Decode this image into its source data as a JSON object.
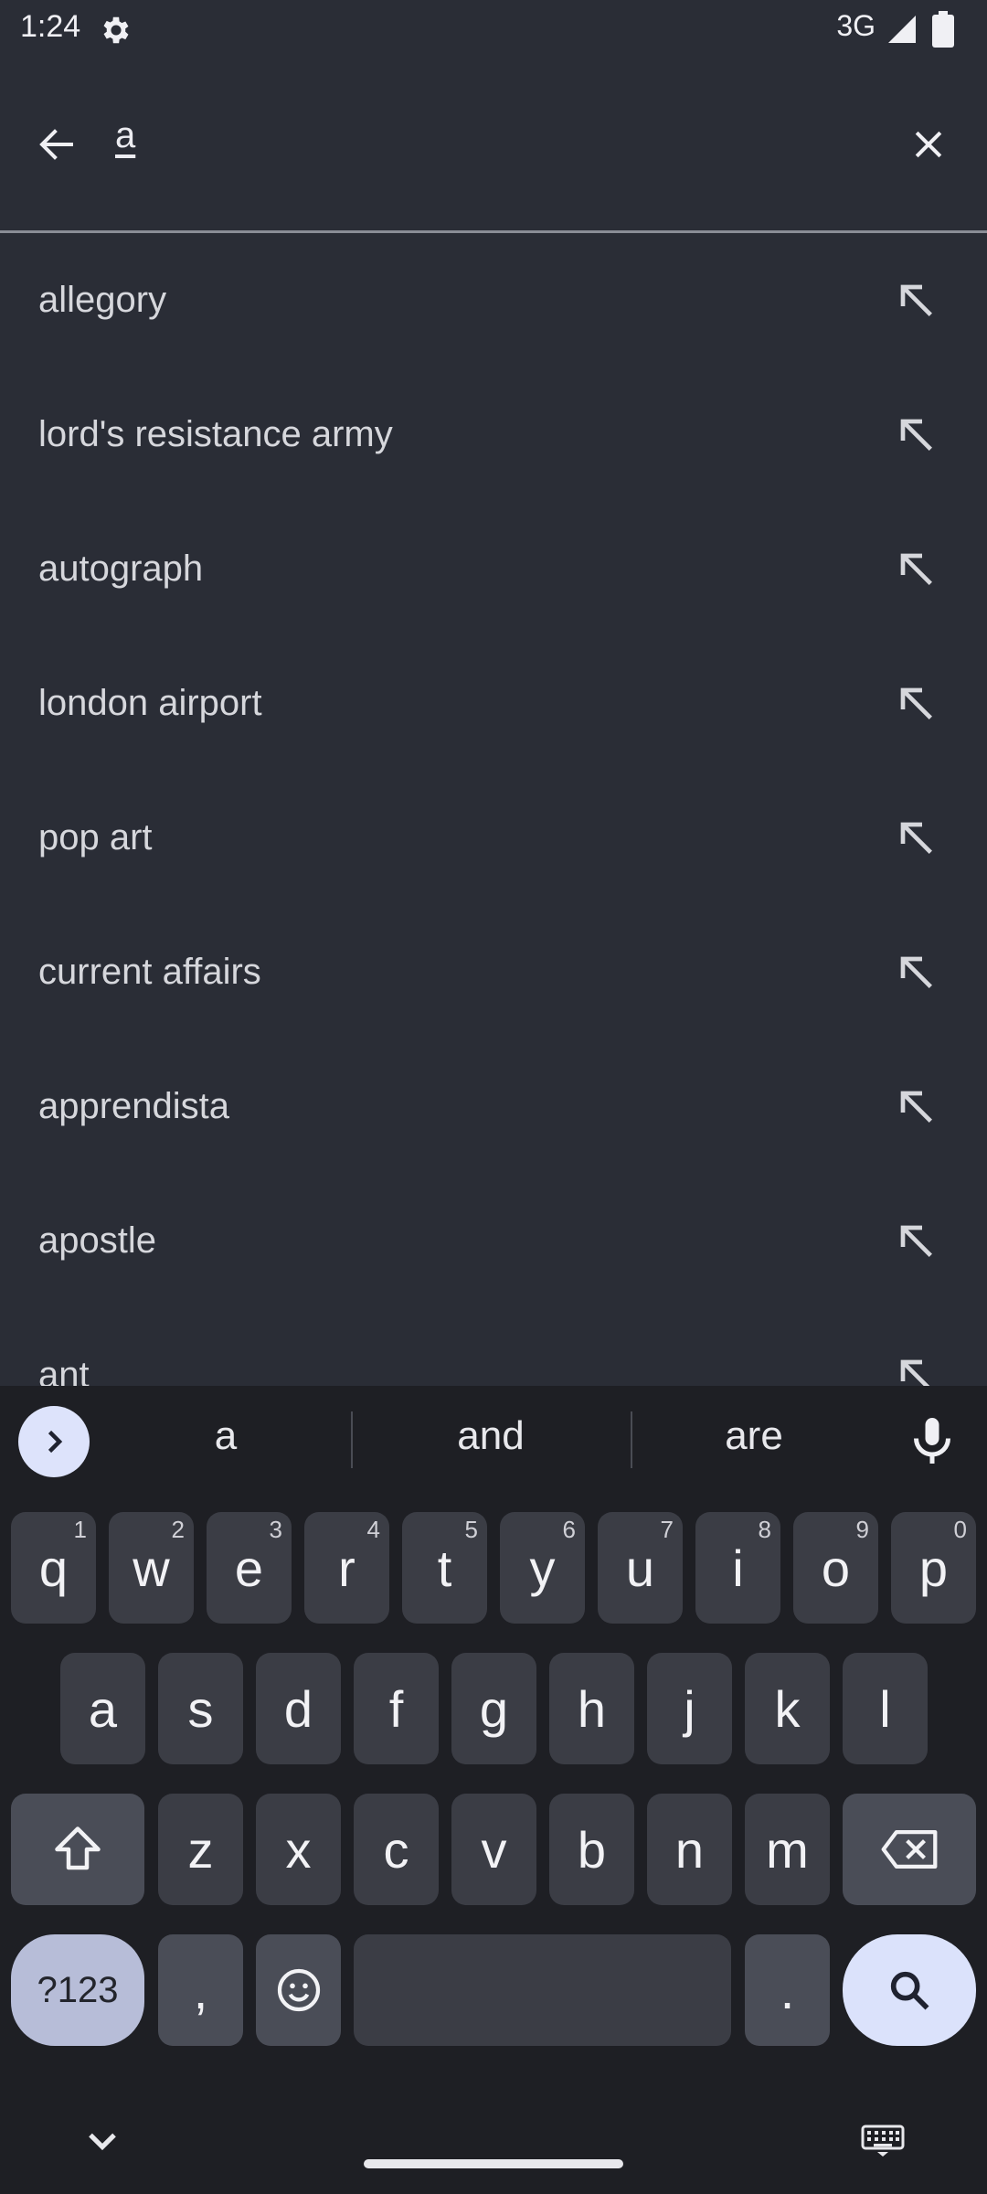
{
  "status_bar": {
    "time": "1:24",
    "network": "3G"
  },
  "search": {
    "query": "a"
  },
  "suggestions": [
    {
      "text": "allegory"
    },
    {
      "text": "lord's resistance army"
    },
    {
      "text": "autograph"
    },
    {
      "text": "london airport"
    },
    {
      "text": "pop art"
    },
    {
      "text": "current affairs"
    },
    {
      "text": "apprendista"
    },
    {
      "text": "apostle"
    },
    {
      "text": "ant"
    }
  ],
  "keyboard": {
    "word_suggestions": [
      "a",
      "and",
      "are"
    ],
    "row1": [
      {
        "key": "q",
        "hint": "1"
      },
      {
        "key": "w",
        "hint": "2"
      },
      {
        "key": "e",
        "hint": "3"
      },
      {
        "key": "r",
        "hint": "4"
      },
      {
        "key": "t",
        "hint": "5"
      },
      {
        "key": "y",
        "hint": "6"
      },
      {
        "key": "u",
        "hint": "7"
      },
      {
        "key": "i",
        "hint": "8"
      },
      {
        "key": "o",
        "hint": "9"
      },
      {
        "key": "p",
        "hint": "0"
      }
    ],
    "row2": [
      "a",
      "s",
      "d",
      "f",
      "g",
      "h",
      "j",
      "k",
      "l"
    ],
    "row3": [
      "z",
      "x",
      "c",
      "v",
      "b",
      "n",
      "m"
    ],
    "mode_label": "?123",
    "comma": ",",
    "period": "."
  }
}
